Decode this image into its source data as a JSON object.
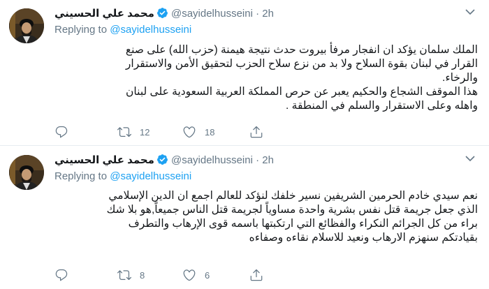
{
  "tweets": [
    {
      "name": "محمد علي الحسيني",
      "handle": "@sayidelhusseini",
      "dot": "·",
      "time": "2h",
      "replying_prefix": "Replying to",
      "replying_handle": "@sayidelhusseini",
      "lines": [
        "الملك سلمان يؤكد ان انفجار مرفأ بيروت حدث نتيجة هيمنة (حزب الله) على صنع",
        "القرار في لبنان بقوة السلاح ولا بد من نزع سلاح الحزب لتحقيق الأمن والاستقرار",
        "والرخاء.",
        "هذا الموقف الشجاع والحكيم يعبر عن حرص المملكة العربية السعودية على لبنان",
        "واهله وعلى الاستقرار والسلم في المنطقة ."
      ],
      "reply_count": "",
      "retweet_count": "12",
      "like_count": "18"
    },
    {
      "name": "محمد علي الحسيني",
      "handle": "@sayidelhusseini",
      "dot": "·",
      "time": "2h",
      "replying_prefix": "Replying to",
      "replying_handle": "@sayidelhusseini",
      "lines": [
        "نعم سيدي خادم الحرمين الشريفين نسير خلفك لنؤكد للعالم اجمع  ان الدين الإسلامي",
        "الذي جعل جريمة قتل نفس بشرية واحدة مساوياً لجريمة قتل الناس جميعاً,هو بلا شك",
        "براء من كل الجرائم النكراء والفظائع التي ارتكبتها باسمه قوى الإرهاب والتطرف",
        "بقيادتكم سنهزم الارهاب ونعيد للاسلام نقاءه وصفاءه"
      ],
      "reply_count": "",
      "retweet_count": "8",
      "like_count": "6"
    }
  ],
  "colors": {
    "accent": "#1da1f2",
    "verified": "#1da1f2",
    "muted": "#657786",
    "text": "#14171a",
    "divider": "#e6ecf0"
  },
  "icons": {
    "verified": "verified-badge-icon",
    "reply": "reply-icon",
    "retweet": "retweet-icon",
    "like": "heart-icon",
    "share": "share-icon",
    "more": "chevron-down-icon"
  }
}
